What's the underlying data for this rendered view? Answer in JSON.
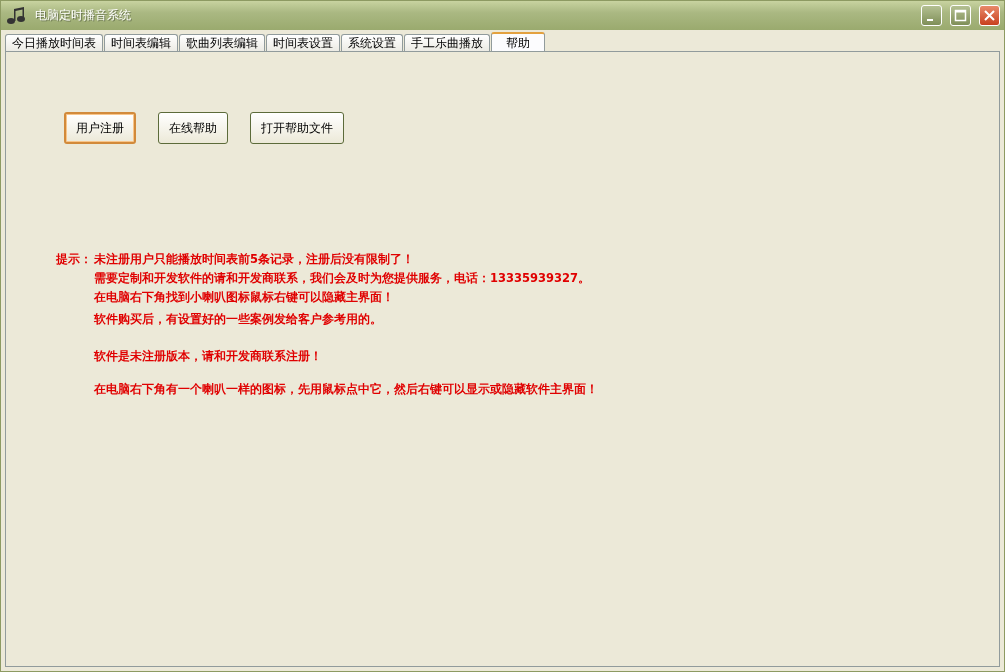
{
  "window": {
    "title": "电脑定时播音系统"
  },
  "tabs": [
    {
      "label": "今日播放时间表",
      "selected": false
    },
    {
      "label": "时间表编辑",
      "selected": false
    },
    {
      "label": "歌曲列表编辑",
      "selected": false
    },
    {
      "label": "时间表设置",
      "selected": false
    },
    {
      "label": "系统设置",
      "selected": false
    },
    {
      "label": "手工乐曲播放",
      "selected": false
    },
    {
      "label": "帮助",
      "selected": true
    }
  ],
  "buttons": [
    {
      "label": "用户注册",
      "focused": true
    },
    {
      "label": "在线帮助",
      "focused": false
    },
    {
      "label": "打开帮助文件",
      "focused": false
    }
  ],
  "notice": {
    "label": "提示：",
    "lines": [
      "未注册用户只能播放时间表前5条记录，注册后没有限制了！",
      "需要定制和开发软件的请和开发商联系，我们会及时为您提供服务，电话：13335939327。",
      "在电脑右下角找到小喇叭图标鼠标右键可以隐藏主界面！",
      "软件购买后，有设置好的一些案例发给客户参考用的。"
    ]
  },
  "messages": [
    "软件是未注册版本，请和开发商联系注册！",
    "在电脑右下角有一个喇叭一样的图标，先用鼠标点中它，然后右键可以显示或隐藏软件主界面！"
  ]
}
